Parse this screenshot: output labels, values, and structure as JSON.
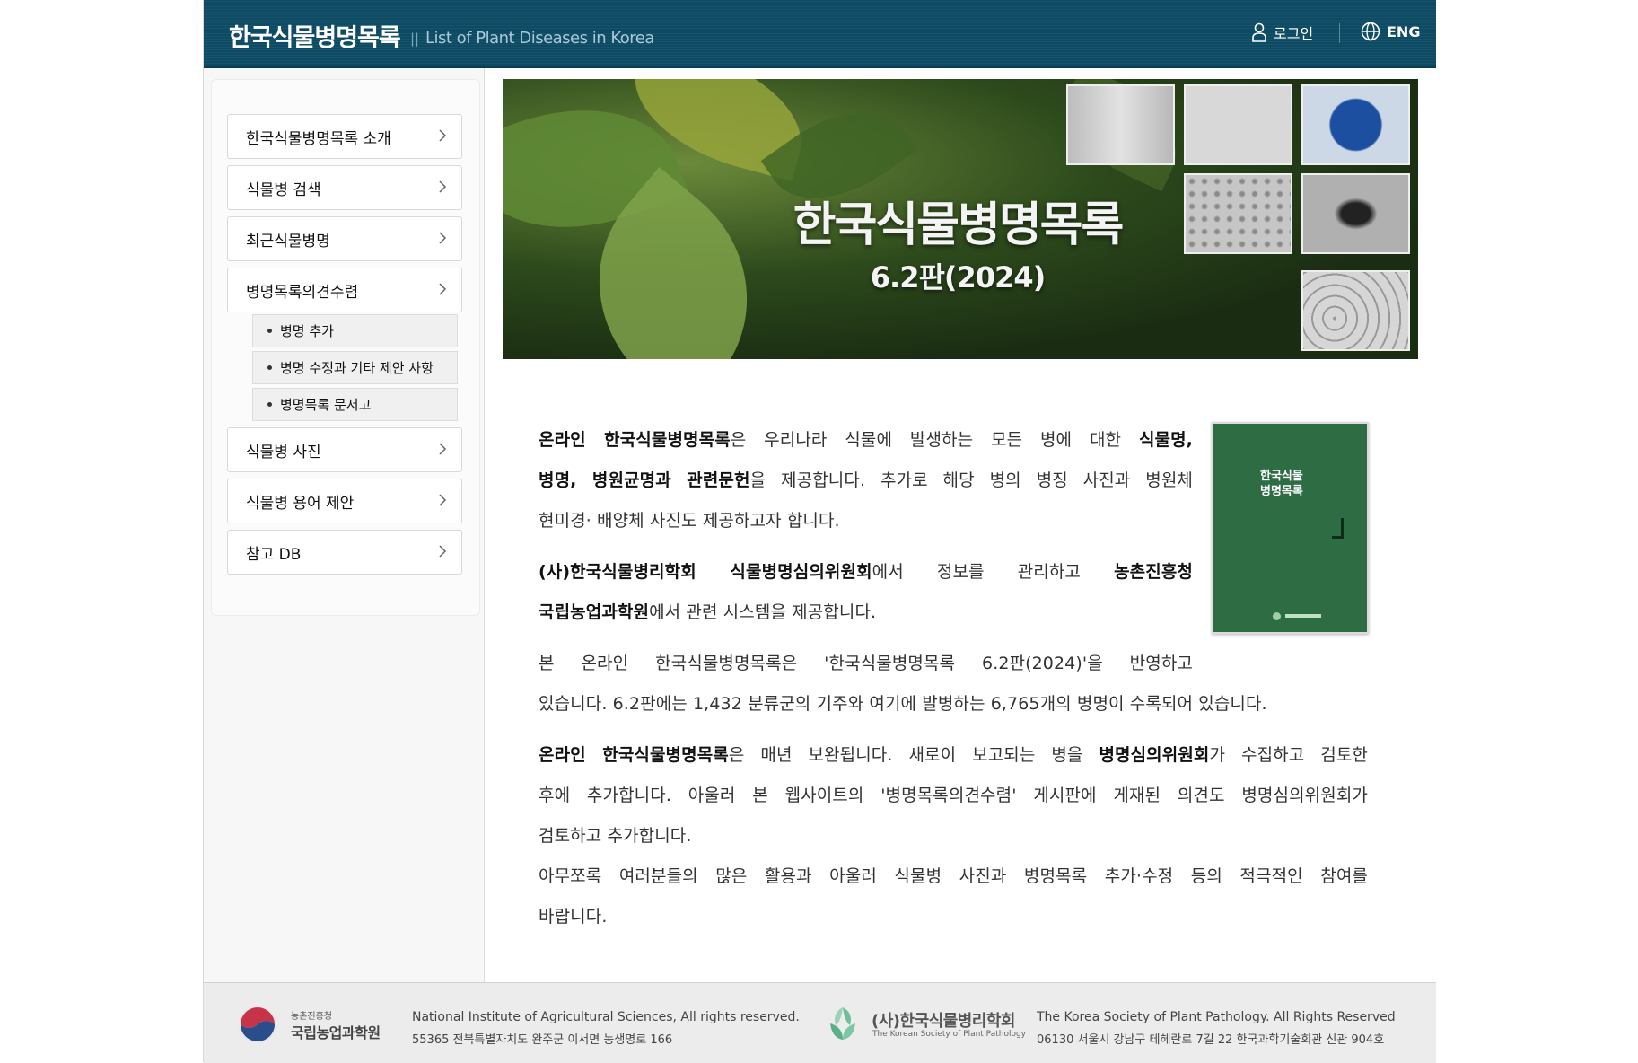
{
  "header": {
    "logo_ko": "한국식물병명목록",
    "logo_sep": "||",
    "logo_en": "List of Plant Diseases in Korea",
    "login_label": "로그인",
    "lang_label": "ENG"
  },
  "sidebar": {
    "items": [
      {
        "label": "한국식물병명목록 소개"
      },
      {
        "label": "식물병 검색"
      },
      {
        "label": "최근식물병명"
      },
      {
        "label": "병명목록의견수렴"
      },
      {
        "label": "식물병 사진"
      },
      {
        "label": "식물병 용어 제안"
      },
      {
        "label": "참고 DB"
      }
    ],
    "sub_items": [
      {
        "label": "병명 추가"
      },
      {
        "label": "병명 수정과 기타 제안 사항"
      },
      {
        "label": "병명목록 문서고"
      }
    ]
  },
  "banner": {
    "title": "한국식물병명목록",
    "subtitle": "6.2판(2024)"
  },
  "book": {
    "title_line1": "한국식물",
    "title_line2": "병명목록"
  },
  "intro": {
    "p1_b1": "온라인 한국식물병명목록",
    "p1_t1": "은 우리나라 식물에 발생하는 모든 병에 대한 ",
    "p1_b2": "식물명,",
    "p1_b3": "병명, 병원균명과 관련문헌",
    "p1_t2": "을 제공합니다. 추가로 해당 병의 병징 사진과 병원체",
    "p1_t3": "현미경· 배양체 사진도 제공하고자 합니다.",
    "p2_b1": "(사)한국식물병리학회 식물병명심의위원회",
    "p2_t1": "에서 정보를 관리하고 ",
    "p2_b2": "농촌진흥청",
    "p2_b3": "국립농업과학원",
    "p2_t2": "에서 관련 시스템을 제공합니다.",
    "p3_t1": "본 온라인 한국식물병명목록은 '한국식물병명목록 6.2판(2024)'을 반영하고",
    "p3_t2": "있습니다. 6.2판에는 1,432 분류군의 기주와 여기에 발병하는 6,765개의 병명이 수록되어 있습니다.",
    "p4_b1": "온라인 한국식물병명목록",
    "p4_t1": "은 매년 보완됩니다. 새로이 보고되는 병을 ",
    "p4_b2": "병명심의위원회",
    "p4_t2": "가 수집하고 검토한",
    "p4_t3": "후에 추가합니다. 아울러 본 웹사이트의 '병명목록의견수렴' 게시판에 게재된 의견도 병명심의위원회가",
    "p4_t4": "검토하고 추가합니다.",
    "p5_t1": "아무쪼록 여러분들의 많은 활용과 아울러 식물병 사진과 병명목록 추가·수정 등의 적극적인 참여를",
    "p5_t2": "바랍니다."
  },
  "footer": {
    "org1_small": "농촌진흥청",
    "org1_big": "국립농업과학원",
    "org1_line1": "National Institute of Agricultural Sciences, All rights reserved.",
    "org1_line2": "55365 전북특별자치도 완주군 이서면 농생명로 166",
    "org2_big": "(사)한국식물병리학회",
    "org2_small": "The Korean Society of Plant Pathology",
    "org2_line1": "The Korea Society of Plant Pathology. All Rights Reserved",
    "org2_line2": "06130 서울시 강남구 테헤란로 7길 22 한국과학기술회관 신관 904호"
  },
  "colors": {
    "header_bg": "#0d4a63",
    "book_green": "#2e6d44"
  },
  "icons": [
    "user-icon",
    "globe-icon",
    "chevron-right-icon",
    "bullet-icon",
    "emblem-icon",
    "society-logo-icon"
  ]
}
